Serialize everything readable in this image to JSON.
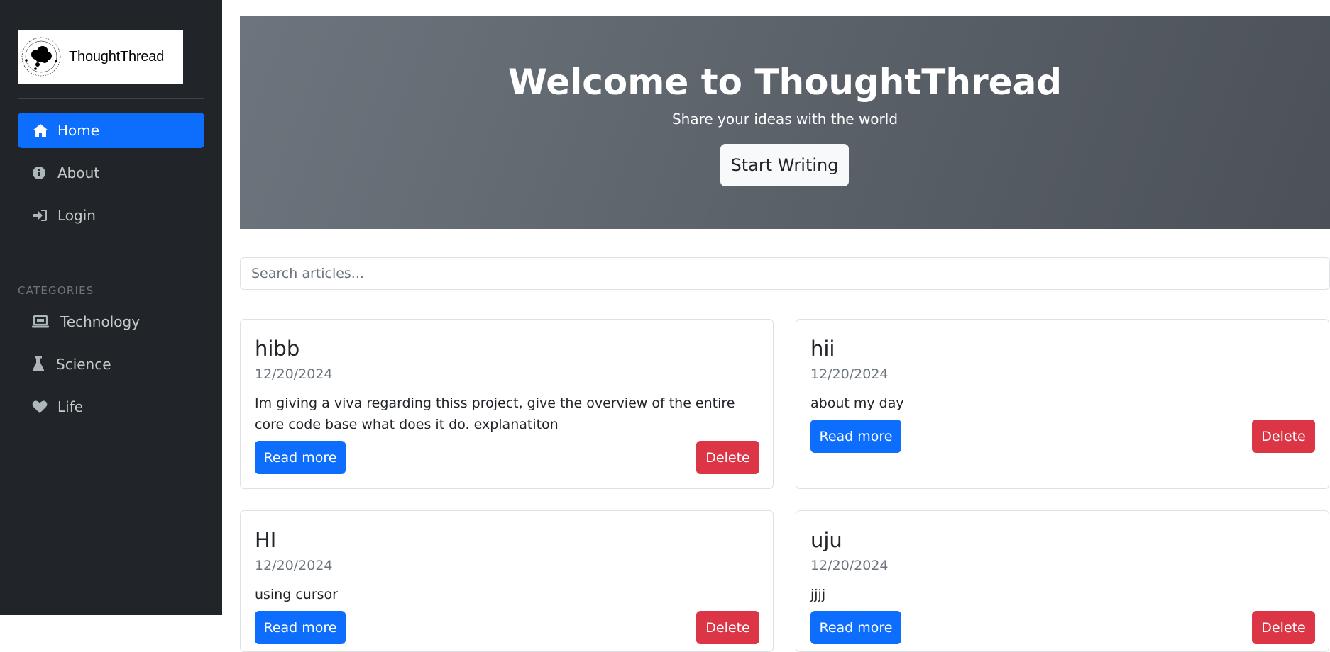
{
  "app": {
    "logo_text": "ThoughtThread",
    "logo_ring_text": "THOUGHTTHREAD"
  },
  "sidebar": {
    "nav": [
      {
        "label": "Home",
        "icon": "home-icon",
        "active": true
      },
      {
        "label": "About",
        "icon": "info-icon",
        "active": false
      },
      {
        "label": "Login",
        "icon": "login-icon",
        "active": false
      }
    ],
    "categories_heading": "CATEGORIES",
    "categories": [
      {
        "label": "Technology",
        "icon": "laptop-icon"
      },
      {
        "label": "Science",
        "icon": "flask-icon"
      },
      {
        "label": "Life",
        "icon": "heart-icon"
      }
    ]
  },
  "hero": {
    "title": "Welcome to ThoughtThread",
    "subtitle": "Share your ideas with the world",
    "button_label": "Start Writing"
  },
  "search": {
    "placeholder": "Search articles...",
    "value": ""
  },
  "articles": [
    {
      "title": "hibb",
      "date": "12/20/2024",
      "excerpt": "Im giving a viva regarding thiss project, give the overview of the entire core code base what does it do. explanatiton",
      "read_label": "Read more",
      "delete_label": "Delete"
    },
    {
      "title": "hii",
      "date": "12/20/2024",
      "excerpt": "about my day",
      "read_label": "Read more",
      "delete_label": "Delete"
    },
    {
      "title": "HI",
      "date": "12/20/2024",
      "excerpt": "using cursor",
      "read_label": "Read more",
      "delete_label": "Delete"
    },
    {
      "title": "uju",
      "date": "12/20/2024",
      "excerpt": "jjjj",
      "read_label": "Read more",
      "delete_label": "Delete"
    }
  ],
  "colors": {
    "sidebar_bg": "#212529",
    "primary": "#0d6efd",
    "danger": "#dc3545",
    "hero_bg": "#6c757d"
  }
}
